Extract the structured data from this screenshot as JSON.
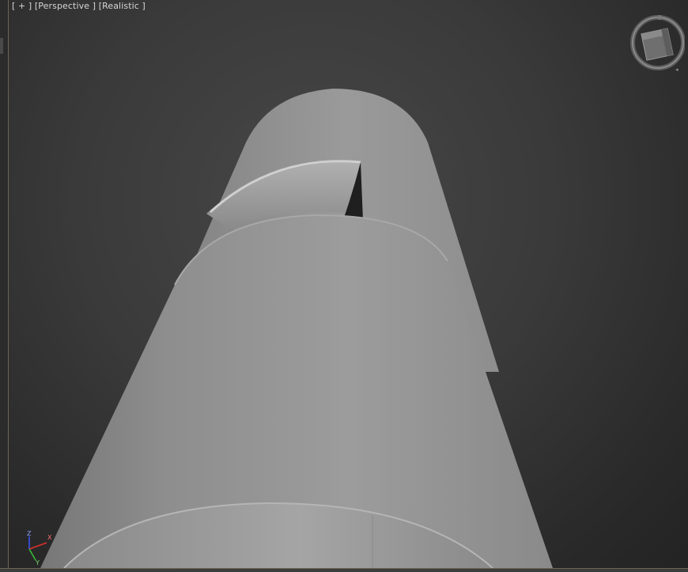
{
  "viewport": {
    "label_plus": "[ + ]",
    "label_view": "[Perspective ]",
    "label_shading": "[Realistic ]"
  },
  "axis": {
    "z": "Z",
    "x": "X",
    "y": "Y",
    "z_color": "#3a56ff",
    "x_color": "#e03030",
    "y_color": "#3ac03a"
  },
  "colors": {
    "background_top": "#2a2a2a",
    "background_center": "#474747",
    "viewport_border": "#6b6554",
    "model_gray": "#9a9a9a"
  },
  "icons": {
    "viewcube": "viewcube-icon",
    "axis": "axis-tripod-icon"
  }
}
